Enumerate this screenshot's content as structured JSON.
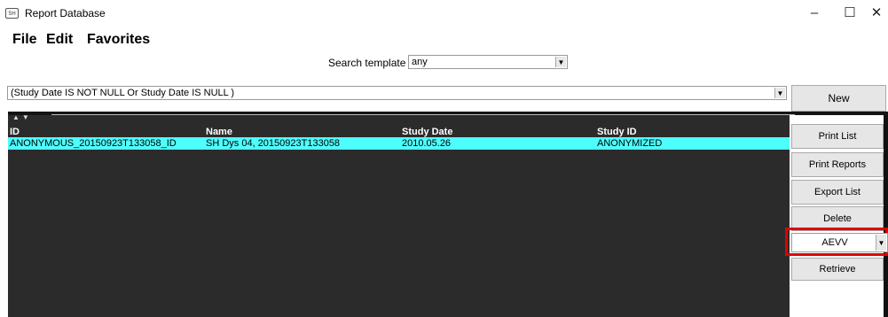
{
  "window": {
    "title": "Report Database",
    "icon_text": "SH",
    "controls": {
      "minimize": "–",
      "maximize": "☐",
      "close": "✕"
    }
  },
  "menu": [
    "File",
    "Edit",
    "Favorites"
  ],
  "search": {
    "label": "Search template",
    "value": "any"
  },
  "query": {
    "value": "(Study Date IS NOT NULL Or Study Date IS NULL )"
  },
  "buttons": {
    "new": "New",
    "print_list": "Print List",
    "print_reports": "Print Reports",
    "export_list": "Export List",
    "delete": "Delete",
    "retrieve": "Retrieve"
  },
  "node_select": {
    "value": "AEVV",
    "highlight_color": "#e00000"
  },
  "table": {
    "columns": [
      "ID",
      "Name",
      "Study Date",
      "Study ID"
    ],
    "rows": [
      [
        "ANONYMOUS_20150923T133058_ID",
        "SH Dys 04, 20150923T133058",
        "2010.05.26",
        "ANONYMIZED"
      ]
    ],
    "selected_color": "#4dfefe",
    "background_color": "#2b2b2b"
  }
}
